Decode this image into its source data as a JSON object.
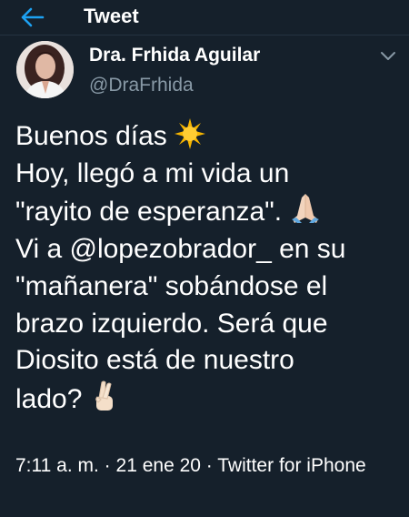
{
  "header": {
    "title": "Tweet"
  },
  "author": {
    "name": "Dra. Frhida Aguilar",
    "handle": "@DraFrhida"
  },
  "tweet": {
    "line1": "Buenos días",
    "line2": "Hoy, llegó a mi vida un",
    "line3": "\"rayito de esperanza\".",
    "line4_pre": "Vi a ",
    "mention": "@lopezobrador_",
    "line4_post": " en su",
    "line5": "\"mañanera\" sobándose el",
    "line6": "brazo izquierdo. Será que",
    "line7": "Diosito está de nuestro",
    "line8": "lado?"
  },
  "meta": {
    "time": "7:11 a. m.",
    "date": "21 ene 20",
    "source": "Twitter for iPhone",
    "separator": "·"
  },
  "icons": {
    "back": "arrow-left-icon",
    "menu": "chevron-down-icon",
    "sun": "sun-emoji",
    "pray": "praying-hands-emoji",
    "fingers": "crossed-fingers-emoji"
  },
  "colors": {
    "background": "#15202b",
    "accent": "#1da1f2",
    "muted": "#8899a6"
  }
}
